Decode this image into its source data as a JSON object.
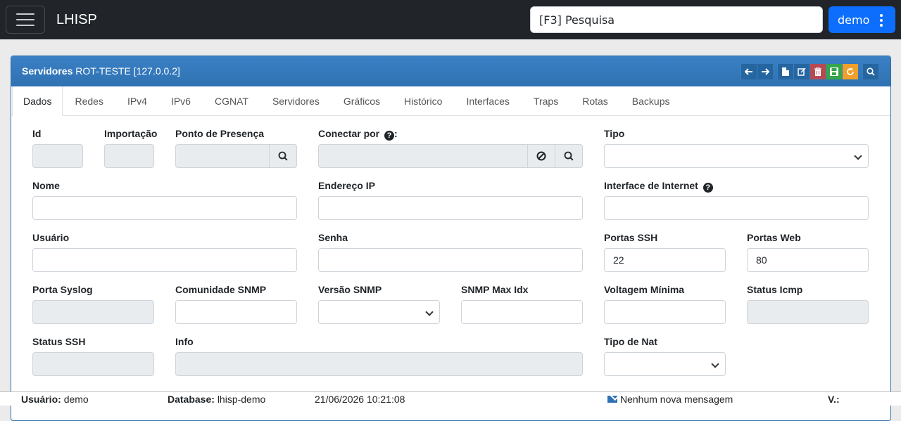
{
  "navbar": {
    "brand": "LHISP",
    "search_placeholder": "[F3] Pesquisa",
    "user_label": "demo"
  },
  "card": {
    "title_bold": "Servidores",
    "title_rest": " ROT-TESTE [127.0.0.2]"
  },
  "tabs": [
    "Dados",
    "Redes",
    "IPv4",
    "IPv6",
    "CGNAT",
    "Servidores",
    "Gráficos",
    "Histórico",
    "Interfaces",
    "Traps",
    "Rotas",
    "Backups"
  ],
  "form": {
    "id_label": "Id",
    "importacao_label": "Importação",
    "ponto_label": "Ponto de Presença",
    "conectar_label": "Conectar por",
    "tipo_label": "Tipo",
    "nome_label": "Nome",
    "endereco_label": "Endereço IP",
    "interface_label": "Interface de Internet",
    "usuario_label": "Usuário",
    "senha_label": "Senha",
    "portas_ssh_label": "Portas SSH",
    "portas_ssh_value": "22",
    "portas_web_label": "Portas Web",
    "portas_web_value": "80",
    "porta_syslog_label": "Porta Syslog",
    "comunidade_label": "Comunidade SNMP",
    "versao_label": "Versão SNMP",
    "snmp_max_label": "SNMP Max Idx",
    "voltagem_label": "Voltagem Mínima",
    "status_icmp_label": "Status Icmp",
    "status_ssh_label": "Status SSH",
    "info_label": "Info",
    "tipo_nat_label": "Tipo de Nat"
  },
  "footer": {
    "usuario_key": "Usuário:",
    "usuario_value": "demo",
    "database_key": "Database:",
    "database_value": "lhisp-demo",
    "datetime": "21/06/2026 10:21:08",
    "messages": "Nenhum nova mensagem",
    "version_key": "V.:"
  },
  "icons": {
    "toolbar": [
      "arrow-left-icon",
      "arrow-right-icon",
      "new-file-icon",
      "edit-icon",
      "trash-icon",
      "save-icon",
      "refresh-icon",
      "search-icon"
    ],
    "colors": {
      "navbar": "#212529",
      "primary": "#0d6efd",
      "card_header": "#3a80c4",
      "delete": "#b54a54",
      "save": "#37a44b",
      "refresh": "#f0a02a"
    }
  }
}
